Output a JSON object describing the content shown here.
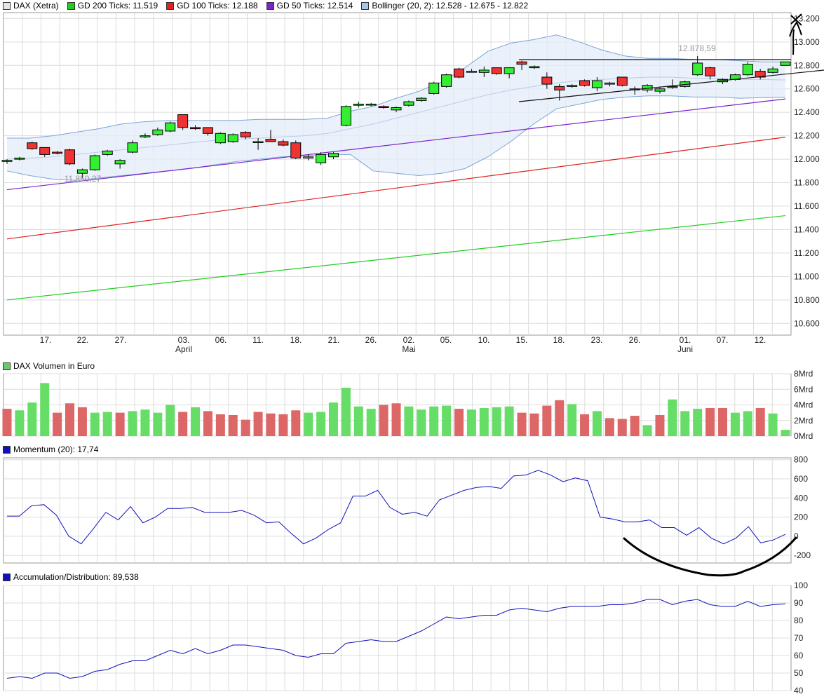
{
  "legend": {
    "price": [
      {
        "label": "DAX (Xetra)",
        "color": "#e6e6e6"
      },
      {
        "label": "GD 200 Ticks: 11.519",
        "color": "#22cc22"
      },
      {
        "label": "GD 100 Ticks: 12.188",
        "color": "#dd2222"
      },
      {
        "label": "GD 50 Ticks: 12.514",
        "color": "#7a22cc"
      },
      {
        "label": "Bollinger (20, 2): 12.528 - 12.675 - 12.822",
        "color": "#a8c4e6"
      }
    ],
    "volume": {
      "label": "DAX Volumen in Euro",
      "color": "#66cc66"
    },
    "momentum": {
      "label": "Momentum (20): 17,74",
      "color": "#1111bb"
    },
    "ad": {
      "label": "Accumulation/Distribution: 89,538",
      "color": "#1111bb"
    }
  },
  "chart_data": [
    {
      "type": "candlestick",
      "title": "DAX (Xetra)",
      "ylim": [
        10500,
        13250
      ],
      "y_ticks": [
        "10.600",
        "10.800",
        "11.000",
        "11.200",
        "11.400",
        "11.600",
        "11.800",
        "12.000",
        "12.200",
        "12.400",
        "12.600",
        "12.800",
        "13.000",
        "13.200"
      ],
      "x_day_labels": [
        "17.",
        "22.",
        "27.",
        "03.",
        "06.",
        "11.",
        "18.",
        "21.",
        "26.",
        "02.",
        "05.",
        "10.",
        "15.",
        "18.",
        "23.",
        "26.",
        "01.",
        "07.",
        "12."
      ],
      "x_month_labels": [
        "April",
        "Mai",
        "Juni"
      ],
      "annotations": [
        "12.878,59",
        "11.850,27"
      ],
      "grid": true,
      "candles": [
        [
          11990,
          12000,
          11960,
          11990
        ],
        [
          12000,
          12020,
          11990,
          12010
        ],
        [
          12140,
          12150,
          12080,
          12090
        ],
        [
          12100,
          12100,
          12020,
          12040
        ],
        [
          12060,
          12070,
          12040,
          12050
        ],
        [
          12080,
          12090,
          11950,
          11960
        ],
        [
          11880,
          11920,
          11840,
          11910
        ],
        [
          11910,
          12040,
          11900,
          12030
        ],
        [
          12040,
          12080,
          12030,
          12070
        ],
        [
          11960,
          12000,
          11920,
          11990
        ],
        [
          12060,
          12160,
          12050,
          12140
        ],
        [
          12190,
          12220,
          12180,
          12200
        ],
        [
          12210,
          12270,
          12200,
          12250
        ],
        [
          12240,
          12320,
          12230,
          12310
        ],
        [
          12380,
          12380,
          12250,
          12270
        ],
        [
          12270,
          12290,
          12250,
          12260
        ],
        [
          12270,
          12270,
          12200,
          12220
        ],
        [
          12140,
          12230,
          12130,
          12220
        ],
        [
          12150,
          12220,
          12140,
          12210
        ],
        [
          12230,
          12240,
          12170,
          12190
        ],
        [
          12150,
          12180,
          12080,
          12150
        ],
        [
          12170,
          12250,
          12150,
          12150
        ],
        [
          12150,
          12170,
          12110,
          12120
        ],
        [
          12140,
          12160,
          12000,
          12010
        ],
        [
          12010,
          12040,
          11990,
          12020
        ],
        [
          11970,
          12060,
          11950,
          12040
        ],
        [
          12020,
          12060,
          12000,
          12050
        ],
        [
          12290,
          12460,
          12280,
          12450
        ],
        [
          12460,
          12490,
          12440,
          12470
        ],
        [
          12470,
          12480,
          12450,
          12470
        ],
        [
          12450,
          12460,
          12430,
          12440
        ],
        [
          12420,
          12450,
          12400,
          12440
        ],
        [
          12460,
          12500,
          12450,
          12490
        ],
        [
          12500,
          12530,
          12490,
          12520
        ],
        [
          12560,
          12660,
          12550,
          12650
        ],
        [
          12620,
          12730,
          12610,
          12720
        ],
        [
          12770,
          12780,
          12690,
          12700
        ],
        [
          12750,
          12770,
          12740,
          12750
        ],
        [
          12740,
          12790,
          12700,
          12760
        ],
        [
          12780,
          12780,
          12720,
          12730
        ],
        [
          12730,
          12780,
          12690,
          12780
        ],
        [
          12830,
          12840,
          12760,
          12810
        ],
        [
          12780,
          12800,
          12770,
          12790
        ],
        [
          12700,
          12740,
          12600,
          12640
        ],
        [
          12620,
          12640,
          12500,
          12590
        ],
        [
          12620,
          12640,
          12610,
          12630
        ],
        [
          12670,
          12680,
          12620,
          12630
        ],
        [
          12610,
          12700,
          12580,
          12670
        ],
        [
          12640,
          12660,
          12620,
          12650
        ],
        [
          12700,
          12700,
          12620,
          12630
        ],
        [
          12600,
          12620,
          12550,
          12600
        ],
        [
          12590,
          12640,
          12570,
          12630
        ],
        [
          12580,
          12620,
          12560,
          12600
        ],
        [
          12620,
          12680,
          12600,
          12620
        ],
        [
          12620,
          12670,
          12610,
          12660
        ],
        [
          12720,
          12880,
          12710,
          12820
        ],
        [
          12780,
          12790,
          12680,
          12710
        ],
        [
          12660,
          12690,
          12640,
          12680
        ],
        [
          12680,
          12730,
          12670,
          12720
        ],
        [
          12720,
          12830,
          12710,
          12810
        ],
        [
          12750,
          12770,
          12680,
          12700
        ],
        [
          12740,
          12790,
          12730,
          12770
        ],
        [
          12800,
          12830,
          12800,
          12830
        ]
      ],
      "series": [
        {
          "name": "GD 200 Ticks",
          "color": "#22cc22",
          "values": [
            10800,
            11519
          ]
        },
        {
          "name": "GD 100 Ticks",
          "color": "#dd2222",
          "values": [
            11320,
            12188
          ]
        },
        {
          "name": "GD 50 Ticks",
          "color": "#7a22cc",
          "values": [
            11740,
            12514
          ]
        },
        {
          "name": "Bollinger upper",
          "color": "#7aa4d6",
          "values": [
            12180,
            12180,
            12200,
            12230,
            12260,
            12300,
            12320,
            12330,
            12330,
            12330,
            12330,
            12340,
            12340,
            12340,
            12350,
            12410,
            12450,
            12520,
            12580,
            12660,
            12780,
            12920,
            12990,
            13020,
            13060,
            13000,
            12930,
            12880,
            12860,
            12860,
            12850,
            12850,
            12840,
            12830,
            12830
          ]
        },
        {
          "name": "Bollinger middle",
          "color": "#b8cde8",
          "values": [
            12000,
            12010,
            12020,
            12040,
            12060,
            12080,
            12100,
            12120,
            12140,
            12160,
            12170,
            12180,
            12190,
            12200,
            12220,
            12260,
            12300,
            12350,
            12400,
            12450,
            12500,
            12550,
            12590,
            12620,
            12650,
            12670,
            12680,
            12690,
            12700,
            12700,
            12690,
            12690,
            12680,
            12680,
            12675
          ]
        },
        {
          "name": "Bollinger lower",
          "color": "#7aa4d6",
          "values": [
            11900,
            11860,
            11830,
            11820,
            11840,
            11860,
            11880,
            11900,
            11920,
            11950,
            11980,
            12000,
            12020,
            12030,
            12040,
            12040,
            11900,
            11880,
            11860,
            11880,
            11920,
            12020,
            12150,
            12300,
            12430,
            12470,
            12510,
            12530,
            12540,
            12540,
            12530,
            12530,
            12520,
            12525,
            12528
          ]
        }
      ]
    },
    {
      "type": "bar",
      "title": "DAX Volumen in Euro",
      "unit": "Mrd",
      "y_ticks": [
        "0Mrd",
        "2Mrd",
        "4Mrd",
        "6Mrd",
        "8Mrd"
      ],
      "ylim": [
        0,
        8
      ],
      "values": [
        3.5,
        3.3,
        4.3,
        6.8,
        3.0,
        4.2,
        3.7,
        3.0,
        3.1,
        3.0,
        3.2,
        3.4,
        3.0,
        4.0,
        3.1,
        3.7,
        3.2,
        2.8,
        2.7,
        2.1,
        3.1,
        2.9,
        2.8,
        3.3,
        3.0,
        3.1,
        4.3,
        6.2,
        3.8,
        3.5,
        4.0,
        4.2,
        3.8,
        3.4,
        3.8,
        3.9,
        3.5,
        3.4,
        3.6,
        3.7,
        3.8,
        3.0,
        2.9,
        3.9,
        4.6,
        4.1,
        2.8,
        3.2,
        2.3,
        2.2,
        2.6,
        1.4,
        2.7,
        4.7,
        3.2,
        3.5,
        3.6,
        3.6,
        3.0,
        3.2,
        3.6,
        2.9,
        0.8
      ],
      "colors": [
        "r",
        "g",
        "g",
        "g",
        "r",
        "r",
        "r",
        "g",
        "g",
        "r",
        "g",
        "g",
        "g",
        "g",
        "r",
        "g",
        "r",
        "r",
        "r",
        "r",
        "r",
        "r",
        "r",
        "r",
        "g",
        "g",
        "g",
        "g",
        "g",
        "g",
        "r",
        "r",
        "g",
        "g",
        "g",
        "g",
        "r",
        "g",
        "g",
        "g",
        "g",
        "r",
        "r",
        "r",
        "r",
        "g",
        "r",
        "g",
        "r",
        "r",
        "r",
        "g",
        "r",
        "g",
        "g",
        "g",
        "r",
        "r",
        "g",
        "g",
        "r",
        "g",
        "g"
      ]
    },
    {
      "type": "line",
      "title": "Momentum (20)",
      "y_ticks": [
        "-200",
        "0",
        "200",
        "400",
        "600",
        "800"
      ],
      "ylim": [
        -280,
        820
      ],
      "values": [
        210,
        210,
        320,
        330,
        220,
        0,
        -80,
        80,
        250,
        170,
        310,
        140,
        200,
        290,
        290,
        300,
        250,
        250,
        250,
        270,
        220,
        140,
        150,
        30,
        -80,
        -20,
        70,
        140,
        420,
        420,
        480,
        300,
        230,
        250,
        210,
        380,
        430,
        480,
        510,
        520,
        500,
        630,
        640,
        690,
        640,
        570,
        610,
        580,
        200,
        180,
        150,
        150,
        170,
        90,
        90,
        10,
        90,
        -20,
        -80,
        -20,
        100,
        -70,
        -40,
        20
      ]
    },
    {
      "type": "line",
      "title": "Accumulation/Distribution",
      "y_ticks": [
        "40",
        "50",
        "60",
        "70",
        "80",
        "90",
        "100"
      ],
      "ylim": [
        40,
        100
      ],
      "values": [
        47,
        48,
        47,
        50,
        50,
        47,
        48,
        51,
        52,
        55,
        57,
        57,
        60,
        63,
        61,
        64,
        61,
        63,
        66,
        66,
        65,
        64,
        63,
        60,
        59,
        61,
        61,
        67,
        68,
        69,
        68,
        68,
        71,
        74,
        78,
        82,
        81,
        82,
        83,
        83,
        86,
        87,
        86,
        85,
        87,
        88,
        88,
        88,
        89,
        89,
        90,
        92,
        92,
        89,
        91,
        92,
        89,
        88,
        88,
        91,
        88,
        89,
        89.5
      ]
    }
  ]
}
